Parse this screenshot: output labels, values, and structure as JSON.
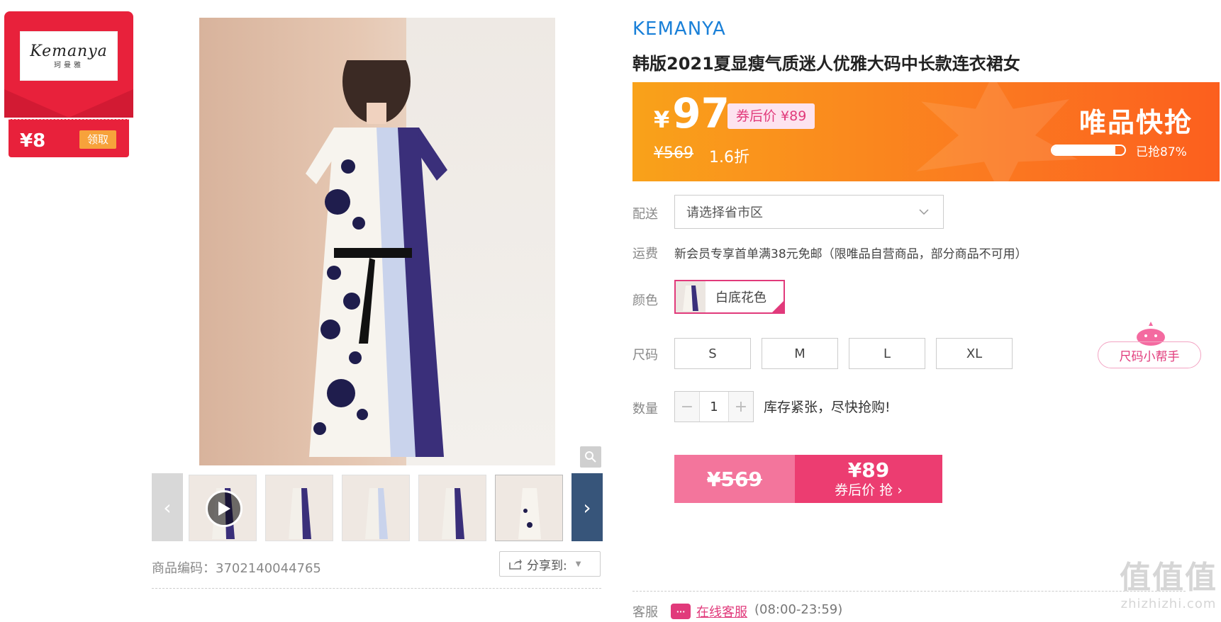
{
  "coupon": {
    "logo_text": "Kemanya",
    "logo_sub": "珂曼雅",
    "amount": "¥8",
    "claim_label": "领取"
  },
  "gallery": {
    "sku_label": "商品编码：3702140044765",
    "share_label": "分享到:",
    "prev_icon": "chevron-left-icon",
    "next_icon": "chevron-right-icon"
  },
  "product": {
    "brand": "KEMANYA",
    "title": "韩版2021夏显瘦气质迷人优雅大码中长款连衣裙女"
  },
  "price": {
    "currency": "¥",
    "current": "97",
    "coupon_tag": "券后价 ¥89",
    "original": "¥569",
    "discount": "1.6折",
    "flash_title": "唯品快抢",
    "sold_progress": 0.87,
    "sold_label": "已抢87%"
  },
  "shipping": {
    "label": "配送",
    "select_placeholder": "请选择省市区"
  },
  "freight": {
    "label": "运费",
    "text": "新会员专享首单满38元免邮（限唯品自营商品，部分商品不可用）"
  },
  "color": {
    "label": "颜色",
    "selected": "白底花色"
  },
  "size": {
    "label": "尺码",
    "options": [
      "S",
      "M",
      "L",
      "XL"
    ],
    "helper": "尺码小帮手"
  },
  "quantity": {
    "label": "数量",
    "minus": "−",
    "value": "1",
    "plus": "+",
    "stock_note": "库存紧张，尽快抢购!"
  },
  "buy": {
    "original": "¥569",
    "price": "¥89",
    "cta": "券后价 抢 ›"
  },
  "service": {
    "label": "客服",
    "link": "在线客服",
    "hours": "(08:00-23:59)"
  },
  "watermark": {
    "line1": "值值值",
    "line2": "zhizhizhi.com"
  },
  "colors": {
    "accent_pink": "#ec3d71",
    "brand_blue": "#1a80d8",
    "banner_orange": "#fb7a20",
    "coupon_red": "#e8213b"
  }
}
